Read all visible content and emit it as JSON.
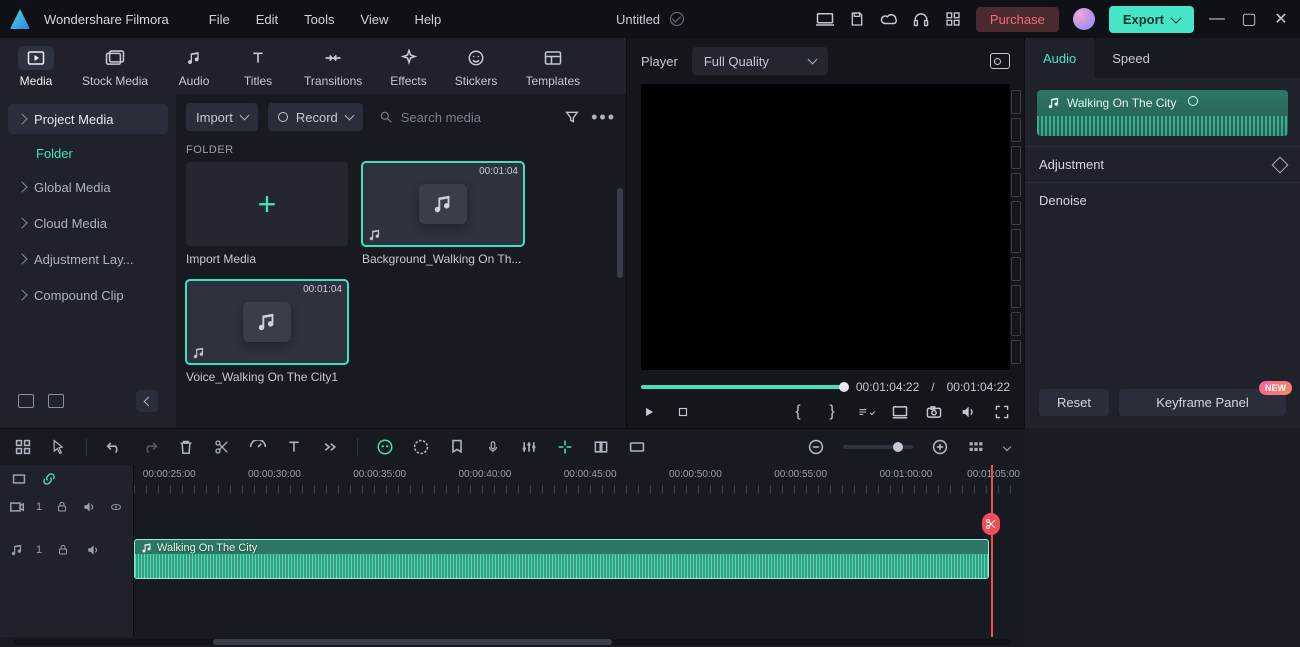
{
  "app_title": "Wondershare Filmora",
  "menu": {
    "file": "File",
    "edit": "Edit",
    "tools": "Tools",
    "view": "View",
    "help": "Help"
  },
  "project_name": "Untitled",
  "titlebar": {
    "purchase": "Purchase",
    "export": "Export"
  },
  "tool_tabs": {
    "media": "Media",
    "stock": "Stock Media",
    "audio": "Audio",
    "titles": "Titles",
    "transitions": "Transitions",
    "effects": "Effects",
    "stickers": "Stickers",
    "templates": "Templates"
  },
  "sidebar": {
    "project_media": "Project Media",
    "folder": "Folder",
    "global_media": "Global Media",
    "cloud_media": "Cloud Media",
    "adjustment_layer": "Adjustment Lay...",
    "compound_clip": "Compound Clip"
  },
  "library_toolbar": {
    "import": "Import",
    "record": "Record",
    "search_placeholder": "Search media"
  },
  "library": {
    "folder_header": "FOLDER",
    "cards": {
      "import": "Import Media",
      "bg": {
        "duration": "00:01:04",
        "name": "Background_Walking On Th..."
      },
      "voice": {
        "duration": "00:01:04",
        "name": "Voice_Walking On The City1"
      }
    }
  },
  "player": {
    "label": "Player",
    "quality": "Full Quality",
    "current_time": "00:01:04:22",
    "separator": "/",
    "total_time": "00:01:04:22"
  },
  "inspector": {
    "tabs": {
      "audio": "Audio",
      "speed": "Speed"
    },
    "clip_name": "Walking On The City",
    "adjustment": "Adjustment",
    "denoise": "Denoise",
    "reset": "Reset",
    "keyframe_panel": "Keyframe Panel",
    "new_badge": "NEW"
  },
  "timeline": {
    "marks": [
      "00:00:25:00",
      "00:00:30:00",
      "00:00:35:00",
      "00:00:40:00",
      "00:00:45:00",
      "00:00:50:00",
      "00:00:55:00",
      "00:01:00:00",
      "00:01:05:00"
    ],
    "video_track_index": "1",
    "audio_track_index": "1",
    "clip_name": "Walking On The City"
  }
}
